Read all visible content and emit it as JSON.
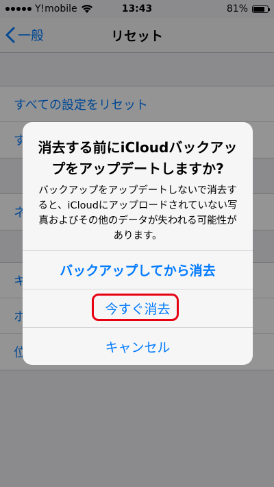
{
  "status": {
    "carrier": "Y!mobile",
    "time": "13:43",
    "battery_text": "81%",
    "battery_level": 0.81
  },
  "nav": {
    "back_label": "一般",
    "title": "リセット"
  },
  "settings_rows": {
    "row1": "すべての設定をリセット",
    "row2": "す",
    "row3": "ネ",
    "row4": "キ",
    "row5": "ホ",
    "row6": "位"
  },
  "alert": {
    "title": "消去する前にiCloudバックアップをアップデートしますか?",
    "message": "バックアップをアップデートしないで消去すると、iCloudにアップロードされていない写真およびその他のデータが失われる可能性があります。",
    "actions": {
      "backup_then_erase": "バックアップしてから消去",
      "erase_now": "今すぐ消去",
      "cancel": "キャンセル"
    }
  },
  "colors": {
    "accent": "#007aff",
    "highlight": "#e60012"
  }
}
